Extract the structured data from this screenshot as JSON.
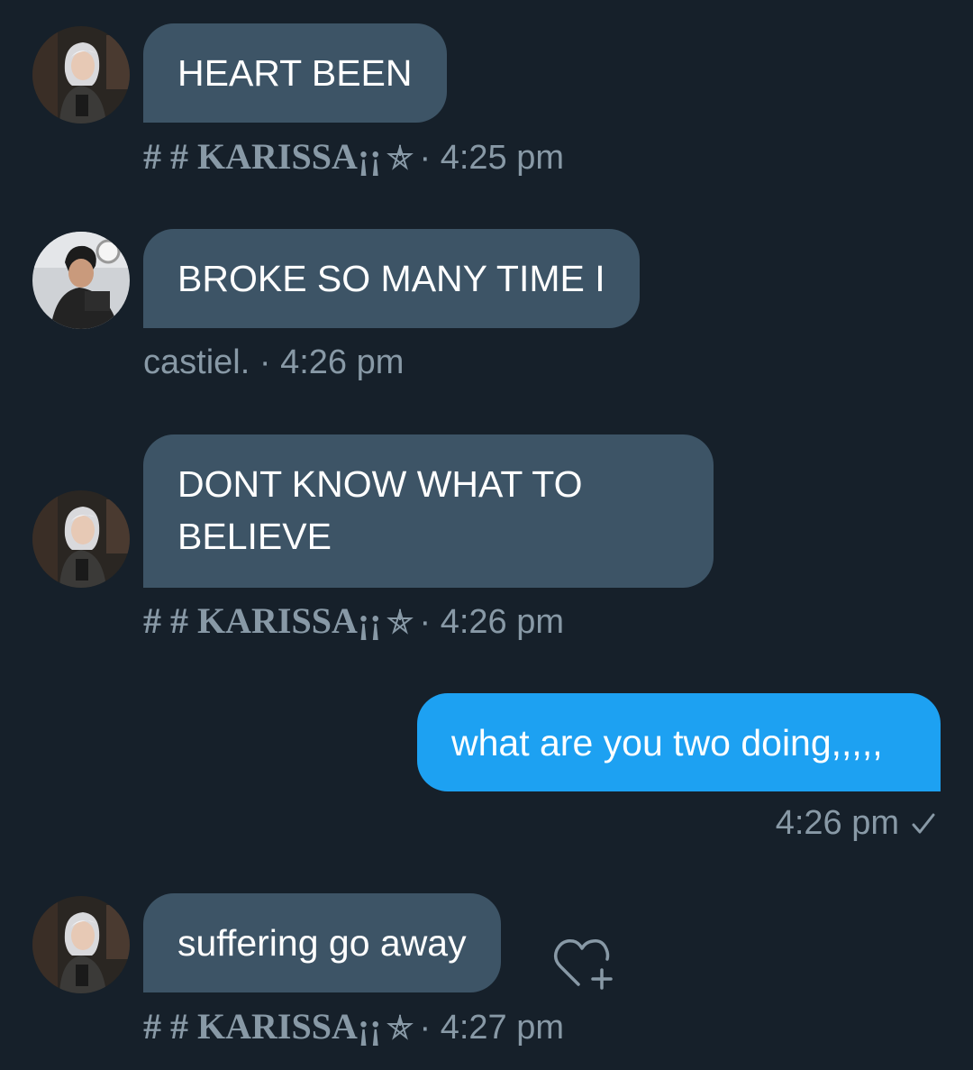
{
  "messages": [
    {
      "direction": "incoming",
      "text": "HEART BEEN",
      "sender": "# # KARISSA¡¡",
      "sender_symbol": "pentagram",
      "separator": "·",
      "time": "4:25 pm"
    },
    {
      "direction": "incoming",
      "text": "BROKE SO MANY TIME I",
      "sender": "castiel.",
      "separator": "·",
      "time": "4:26 pm"
    },
    {
      "direction": "incoming",
      "text_line1": "DONT KNOW WHAT TO",
      "text_line2": "BELIEVE",
      "sender": "# # KARISSA¡¡",
      "sender_symbol": "pentagram",
      "separator": "·",
      "time": "4:26 pm"
    },
    {
      "direction": "outgoing",
      "text": "what are you two doing,,,,,",
      "time": "4:26 pm",
      "status_icon": "checkmark-icon"
    },
    {
      "direction": "incoming",
      "text": "suffering go away",
      "sender": "# # KARISSA¡¡",
      "sender_symbol": "pentagram",
      "separator": "·",
      "time": "4:27 pm",
      "action_icon": "heart-plus-icon"
    }
  ],
  "colors": {
    "background": "#16202a",
    "incoming_bubble": "#3d5466",
    "outgoing_bubble": "#1da1f2",
    "meta_text": "#8899a6",
    "message_text": "#ffffff"
  }
}
